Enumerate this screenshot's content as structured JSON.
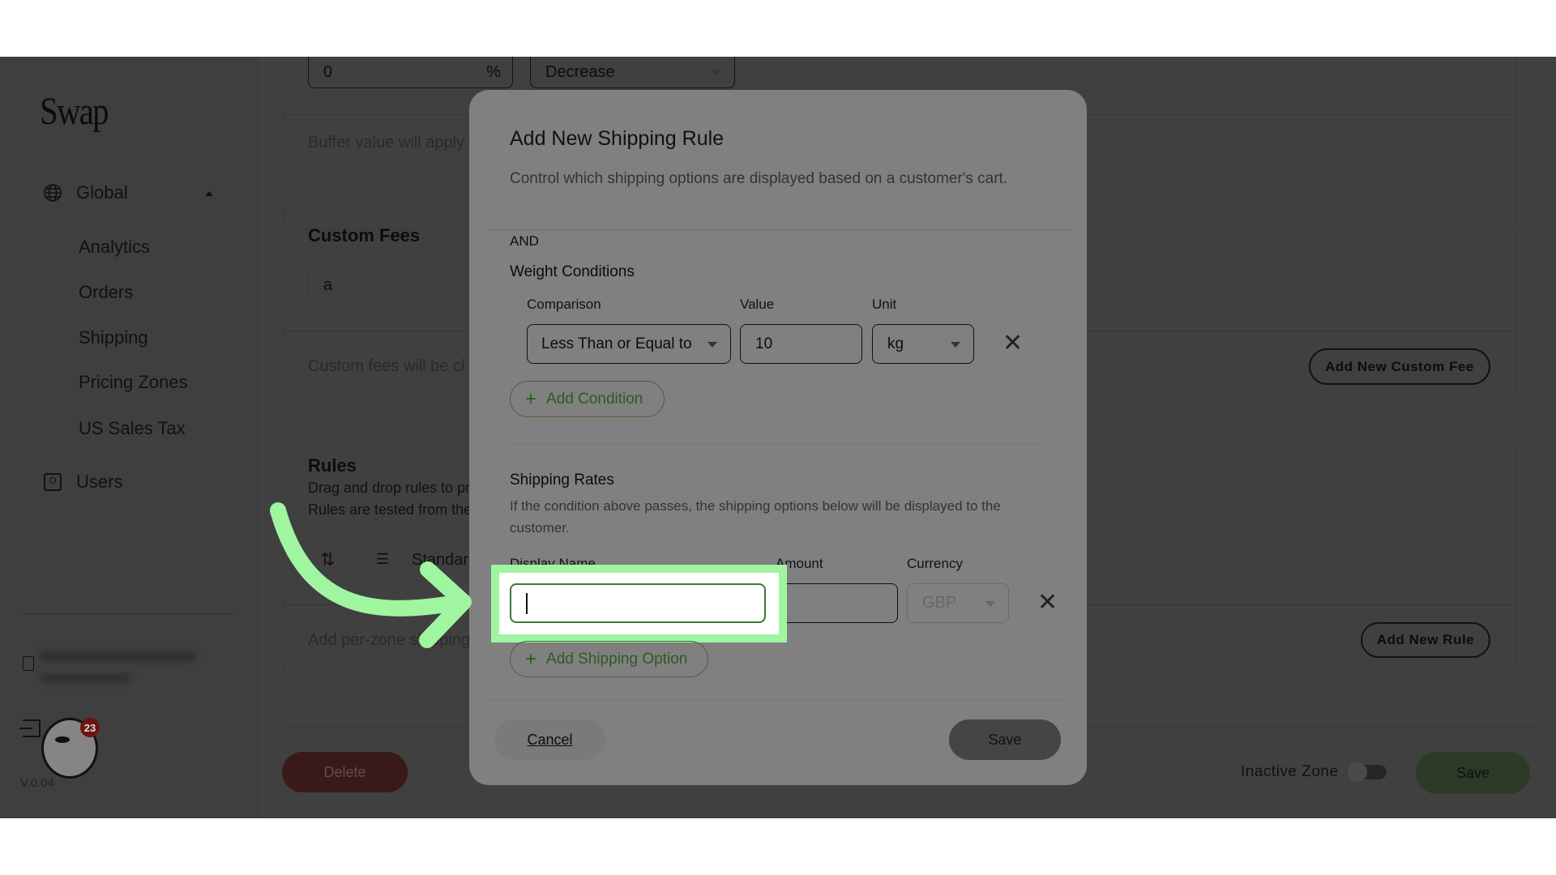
{
  "sidebar": {
    "logo": "Swap",
    "group": {
      "label": "Global",
      "icon": "globe-icon"
    },
    "items": [
      {
        "label": "Analytics"
      },
      {
        "label": "Orders"
      },
      {
        "label": "Shipping"
      },
      {
        "label": "Pricing Zones"
      },
      {
        "label": "US Sales Tax"
      }
    ],
    "users": {
      "label": "Users",
      "icon": "user-icon"
    },
    "notification_count": "23",
    "version": "V.0.04"
  },
  "main": {
    "buffer": {
      "value": "0",
      "unit": "%",
      "direction": "Decrease",
      "note": "Buffer value will apply"
    },
    "custom_fees": {
      "title": "Custom Fees",
      "input_value": "a",
      "note": "Custom fees will be cl",
      "add_button": "Add New Custom Fee"
    },
    "rules": {
      "title": "Rules",
      "desc1": "Drag and drop rules to pr",
      "desc2": "Rules are tested from the",
      "rule_name": "Standar",
      "note": "Add per-zone shipping",
      "add_button": "Add New Rule"
    },
    "footer": {
      "delete": "Delete",
      "inactive_label": "Inactive Zone",
      "inactive_on": false,
      "save": "Save"
    }
  },
  "modal": {
    "title": "Add New Shipping Rule",
    "description": "Control which shipping options are displayed based on a customer's cart.",
    "and_label": "AND",
    "weight": {
      "title": "Weight Conditions",
      "labels": {
        "comparison": "Comparison",
        "value": "Value",
        "unit": "Unit"
      },
      "comparison": "Less Than or Equal to",
      "value": "10",
      "unit": "kg",
      "add_button": "Add Condition"
    },
    "rates": {
      "title": "Shipping Rates",
      "description": "If the condition above passes, the shipping options below will be displayed to the customer.",
      "labels": {
        "display_name": "Display Name",
        "amount": "Amount",
        "currency": "Currency"
      },
      "display_name": "",
      "amount": "",
      "currency": "GBP",
      "add_button": "Add Shipping Option"
    },
    "cancel": "Cancel",
    "save": "Save"
  },
  "colors": {
    "highlight": "#a0f5a0",
    "accent_green": "#2d5a22",
    "delete": "#3a1a18"
  }
}
